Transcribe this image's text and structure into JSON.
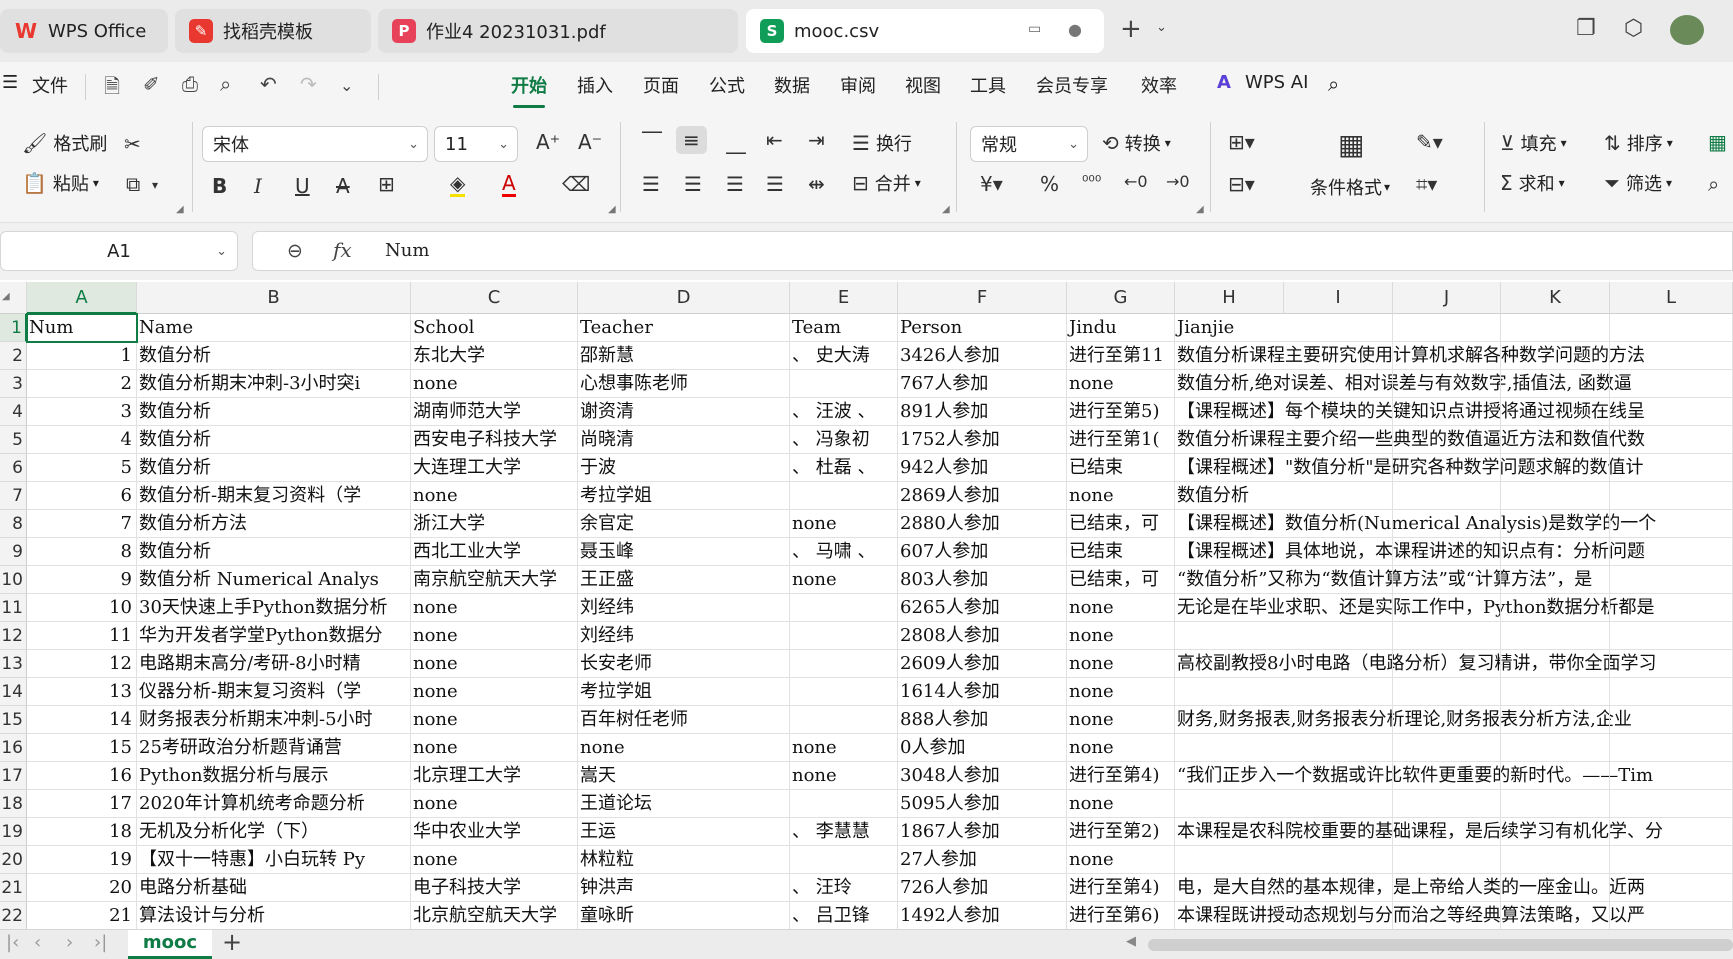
{
  "tabs": [
    {
      "label": "WPS Office",
      "icon": "wps-logo-icon",
      "icon_color": "#e8382f"
    },
    {
      "label": "找稻壳模板",
      "icon": "docer-icon",
      "icon_color": "#e8382f"
    },
    {
      "label": "作业4 20231031.pdf",
      "icon": "pdf-icon",
      "icon_color": "#e8425a"
    },
    {
      "label": "mooc.csv",
      "icon": "sheet-icon",
      "icon_color": "#0f9d58",
      "active": true
    }
  ],
  "menu": {
    "file": "文件",
    "items": [
      "开始",
      "插入",
      "页面",
      "公式",
      "数据",
      "审阅",
      "视图",
      "工具",
      "会员专享",
      "效率"
    ],
    "active": "开始",
    "wps_ai": "WPS AI"
  },
  "ribbon": {
    "format_painter": "格式刷",
    "paste": "粘贴",
    "font_name": "宋体",
    "font_size": "11",
    "wrap": "换行",
    "merge": "合并",
    "number_format": "常规",
    "convert": "转换",
    "conditional_format": "条件格式",
    "fill": "填充",
    "sort": "排序",
    "sum": "求和",
    "filter": "筛选"
  },
  "formula_bar": {
    "name_box": "A1",
    "fx": "fx",
    "content": "Num"
  },
  "columns": [
    "A",
    "B",
    "C",
    "D",
    "E",
    "F",
    "G",
    "H",
    "I",
    "J",
    "K",
    "L"
  ],
  "selected_column": "A",
  "rows": [
    [
      "Num",
      "Name",
      "School",
      "Teacher",
      "Team",
      "Person",
      "Jindu",
      "Jianjie"
    ],
    [
      "1",
      "数值分析",
      "东北大学",
      "邵新慧",
      "、 史大涛",
      "3426人参加",
      "进行至第11",
      "数值分析课程主要研究使用计算机求解各种数学问题的方法"
    ],
    [
      "2",
      "数值分析期末冲刺-3小时突i",
      "none",
      "心想事陈老师",
      "",
      "767人参加",
      "none",
      "数值分析,绝对误差、相对误差与有效数字,插值法, 函数逼"
    ],
    [
      "3",
      "数值分析",
      "湖南师范大学",
      "谢资清",
      "、 汪波 、",
      "891人参加",
      "进行至第5)",
      "【课程概述】每个模块的关键知识点讲授将通过视频在线呈"
    ],
    [
      "4",
      "数值分析",
      "西安电子科技大学",
      "尚晓清",
      "、 冯象初",
      "1752人参加",
      "进行至第1(",
      "数值分析课程主要介绍一些典型的数值逼近方法和数值代数"
    ],
    [
      "5",
      "数值分析",
      "大连理工大学",
      "于波",
      "、 杜磊 、",
      "942人参加",
      "已结束",
      "【课程概述】\"数值分析\"是研究各种数学问题求解的数值计"
    ],
    [
      "6",
      "数值分析-期末复习资料（学",
      "none",
      "考拉学姐",
      "",
      "2869人参加",
      "none",
      "数值分析"
    ],
    [
      "7",
      "数值分析方法",
      "浙江大学",
      "余官定",
      "none",
      "2880人参加",
      "已结束，可",
      "【课程概述】数值分析(Numerical Analysis)是数学的一个"
    ],
    [
      "8",
      "数值分析",
      "西北工业大学",
      "聂玉峰",
      "、 马啸 、",
      "607人参加",
      "已结束",
      "【课程概述】具体地说，本课程讲述的知识点有：分析问题"
    ],
    [
      "9",
      "数值分析 Numerical Analys",
      "南京航空航天大学",
      "王正盛",
      "none",
      "803人参加",
      "已结束，可",
      "“数值分析”又称为“数值计算方法”或“计算方法”，是"
    ],
    [
      "10",
      "30天快速上手Python数据分析",
      "none",
      "刘经纬",
      "",
      "6265人参加",
      "none",
      "无论是在毕业求职、还是实际工作中，Python数据分析都是"
    ],
    [
      "11",
      "华为开发者学堂Python数据分",
      "none",
      "刘经纬",
      "",
      "2808人参加",
      "none",
      ""
    ],
    [
      "12",
      "电路期末高分/考研-8小时精",
      "none",
      "长安老师",
      "",
      "2609人参加",
      "none",
      "高校副教授8小时电路（电路分析）复习精讲，带你全面学习"
    ],
    [
      "13",
      "仪器分析-期末复习资料（学",
      "none",
      "考拉学姐",
      "",
      "1614人参加",
      "none",
      ""
    ],
    [
      "14",
      "财务报表分析期末冲刺-5小时",
      "none",
      "百年树任老师",
      "",
      "888人参加",
      "none",
      "财务,财务报表,财务报表分析理论,财务报表分析方法,企业"
    ],
    [
      "15",
      "25考研政治分析题背诵营",
      "none",
      "none",
      "none",
      "0人参加",
      "none",
      ""
    ],
    [
      "16",
      "Python数据分析与展示",
      "北京理工大学",
      "嵩天",
      "none",
      "3048人参加",
      "进行至第4)",
      "“我们正步入一个数据或许比软件更重要的新时代。——Tim"
    ],
    [
      "17",
      "2020年计算机统考命题分析",
      "none",
      "王道论坛",
      "",
      "5095人参加",
      "none",
      ""
    ],
    [
      "18",
      "无机及分析化学（下）",
      "华中农业大学",
      "王运",
      "、 李慧慧",
      "1867人参加",
      "进行至第2)",
      "本课程是农科院校重要的基础课程，是后续学习有机化学、分"
    ],
    [
      "19",
      "【双十一特惠】小白玩转 Py",
      "none",
      "林粒粒",
      "",
      "27人参加",
      "none",
      ""
    ],
    [
      "20",
      "电路分析基础",
      "电子科技大学",
      "钟洪声",
      "、 汪玲",
      "726人参加",
      "进行至第4)",
      "电，是大自然的基本规律，是上帝给人类的一座金山。近两"
    ],
    [
      "21",
      "算法设计与分析",
      "北京航空航天大学",
      "童咏昕",
      "、 吕卫锋",
      "1492人参加",
      "进行至第6)",
      "本课程既讲授动态规划与分而治之等经典算法策略，又以严"
    ]
  ],
  "sheets": [
    "mooc"
  ],
  "colors": {
    "accent": "#0f7b45",
    "tabbar": "#ebebeb"
  }
}
